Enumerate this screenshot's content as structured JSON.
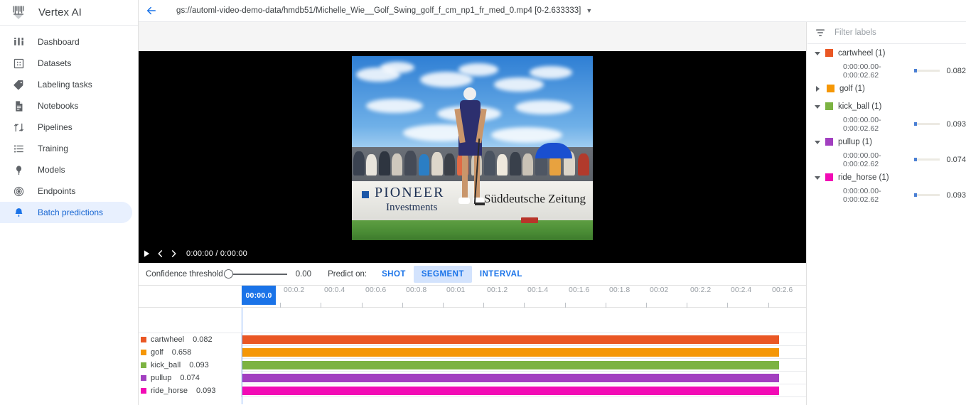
{
  "brand": {
    "title": "Vertex AI",
    "logo_icon": "vertex-ai-logo-icon"
  },
  "sidebar": {
    "items": [
      {
        "label": "Dashboard",
        "icon": "dashboard-icon",
        "active": false
      },
      {
        "label": "Datasets",
        "icon": "datasets-icon",
        "active": false
      },
      {
        "label": "Labeling tasks",
        "icon": "tag-icon",
        "active": false
      },
      {
        "label": "Notebooks",
        "icon": "notebook-icon",
        "active": false
      },
      {
        "label": "Pipelines",
        "icon": "pipelines-icon",
        "active": false
      },
      {
        "label": "Training",
        "icon": "training-list-icon",
        "active": false
      },
      {
        "label": "Models",
        "icon": "models-bulb-icon",
        "active": false
      },
      {
        "label": "Endpoints",
        "icon": "endpoints-target-icon",
        "active": false
      },
      {
        "label": "Batch predictions",
        "icon": "bell-icon",
        "active": true
      }
    ]
  },
  "topbar": {
    "back_icon": "arrow-back-icon",
    "file_path": "gs://automl-video-demo-data/hmdb51/Michelle_Wie__Golf_Swing_golf_f_cm_np1_fr_med_0.mp4 [0-2.633333]",
    "caret_icon": "chevron-down-icon"
  },
  "video": {
    "play_icon": "play-icon",
    "prev_icon": "prev-frame-icon",
    "next_icon": "next-frame-icon",
    "time_display": "0:00:00 / 0:00:00",
    "banner_line1": "PIONEER",
    "banner_line2": "Investments",
    "banner_right": "Süddeutsche Zeitung"
  },
  "controls": {
    "confidence_label": "Confidence threshold",
    "confidence_value": "0.00",
    "predict_on_label": "Predict on:",
    "modes": [
      {
        "label": "SHOT",
        "active": false
      },
      {
        "label": "SEGMENT",
        "active": true
      },
      {
        "label": "INTERVAL",
        "active": false
      }
    ]
  },
  "timeline": {
    "playhead_label": "00:00.0",
    "ticks": [
      "00:0.2",
      "00:0.4",
      "00:0.6",
      "00:0.8",
      "00:01",
      "00:1.2",
      "00:1.4",
      "00:1.6",
      "00:1.8",
      "00:02",
      "00:2.2",
      "00:2.4",
      "00:2.6"
    ],
    "lanes": [
      {
        "name": "cartwheel",
        "score": "0.082",
        "color": "#ea5724"
      },
      {
        "name": "golf",
        "score": "0.658",
        "color": "#f59706"
      },
      {
        "name": "kick_ball",
        "score": "0.093",
        "color": "#7cb342"
      },
      {
        "name": "pullup",
        "score": "0.074",
        "color": "#a23fc0"
      },
      {
        "name": "ride_horse",
        "score": "0.093",
        "color": "#f20bb5"
      }
    ]
  },
  "labels_panel": {
    "filter_icon": "filter-labels-icon",
    "filter_placeholder": "Filter labels",
    "groups": [
      {
        "name": "cartwheel (1)",
        "color": "#ea5724",
        "expanded": true,
        "rows": [
          {
            "time": "0:00:00.00-0:00:02.62",
            "score": "0.082"
          }
        ]
      },
      {
        "name": "golf (1)",
        "color": "#f59706",
        "expanded": false,
        "rows": []
      },
      {
        "name": "kick_ball (1)",
        "color": "#7cb342",
        "expanded": true,
        "rows": [
          {
            "time": "0:00:00.00-0:00:02.62",
            "score": "0.093"
          }
        ]
      },
      {
        "name": "pullup (1)",
        "color": "#a23fc0",
        "expanded": true,
        "rows": [
          {
            "time": "0:00:00.00-0:00:02.62",
            "score": "0.074"
          }
        ]
      },
      {
        "name": "ride_horse (1)",
        "color": "#f20bb5",
        "expanded": true,
        "rows": [
          {
            "time": "0:00:00.00-0:00:02.62",
            "score": "0.093"
          }
        ]
      }
    ]
  },
  "colors": {
    "accent_blue": "#1a73e8",
    "active_nav_bg": "#e8f0fe",
    "segment_active_bg": "#d3e3fd"
  }
}
